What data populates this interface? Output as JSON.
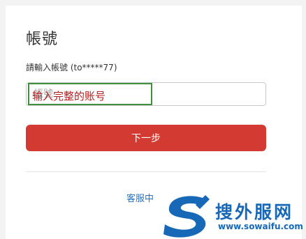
{
  "page_title": "帳號",
  "account_prompt": "請輸入帳號 (to*****77)",
  "account_input": {
    "placeholder": "帳號",
    "value": ""
  },
  "annotation_label": "输入完整的账号",
  "next_button_label": "下一步",
  "support_link_label": "客服中",
  "watermark": {
    "site_name": "搜外服网",
    "url": "www.sowaifu.com"
  },
  "colors": {
    "primary_button": "#d33b32",
    "link": "#2f72b8",
    "annotation_border": "#3f8f3f",
    "annotation_text": "#b61d1d",
    "watermark": "#1769b8"
  }
}
